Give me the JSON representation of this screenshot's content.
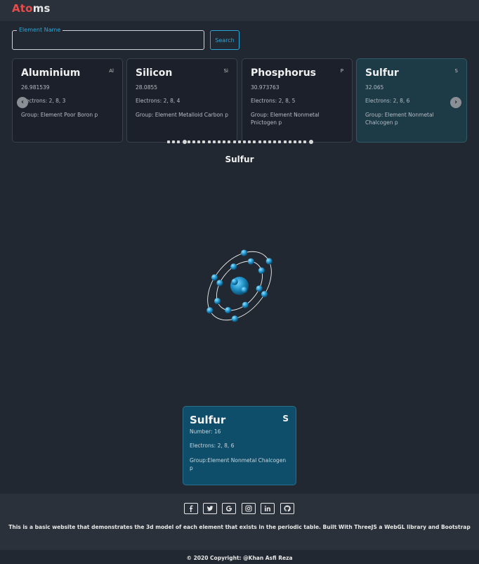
{
  "app": {
    "brand_prefix": "Ato",
    "brand_suffix": "ms"
  },
  "search": {
    "legend": "Element Name",
    "value": "",
    "placeholder": "",
    "button_label": "Search"
  },
  "carousel": {
    "cards": [
      {
        "name": "Aluminium",
        "symbol": "Al",
        "mass": "26.981539",
        "electrons": "Electrons: 2, 8, 3",
        "group": "Group: Element Poor Boron p"
      },
      {
        "name": "Silicon",
        "symbol": "Si",
        "mass": "28.0855",
        "electrons": "Electrons: 2, 8, 4",
        "group": "Group: Element Metalloid Carbon p"
      },
      {
        "name": "Phosphorus",
        "symbol": "P",
        "mass": "30.973763",
        "electrons": "Electrons: 2, 8, 5",
        "group": "Group: Element Nonmetal Pnictogen p"
      },
      {
        "name": "Sulfur",
        "symbol": "S",
        "mass": "32.065",
        "electrons": "Electrons: 2, 8, 6",
        "group": "Group: Element Nonmetal Chalcogen p"
      }
    ],
    "prev_icon": "chevron-left-icon",
    "next_icon": "chevron-right-icon"
  },
  "model": {
    "title": "Sulfur",
    "electron_shells": [
      2,
      8,
      6
    ]
  },
  "info_card": {
    "name": "Sulfur",
    "symbol": "S",
    "number": "Number: 16",
    "electrons": "Electrons: 2, 8, 6",
    "group": "Group:Element Nonmetal Chalcogen p"
  },
  "footer": {
    "social_icons": [
      "facebook-icon",
      "twitter-icon",
      "google-icon",
      "instagram-icon",
      "linkedin-icon",
      "github-icon"
    ],
    "description": "This is a basic website that demonstrates the 3d model of each element that exists in the periodic table. Built With ThreeJS a WebGL library and Bootstrap",
    "copyright": "© 2020 Copyright: @Khan Asfi Reza"
  },
  "colors": {
    "background": "#222831",
    "accent": "#2aa6d8",
    "brand_red": "#e94b4b",
    "active_card": "#0f4e6a"
  }
}
